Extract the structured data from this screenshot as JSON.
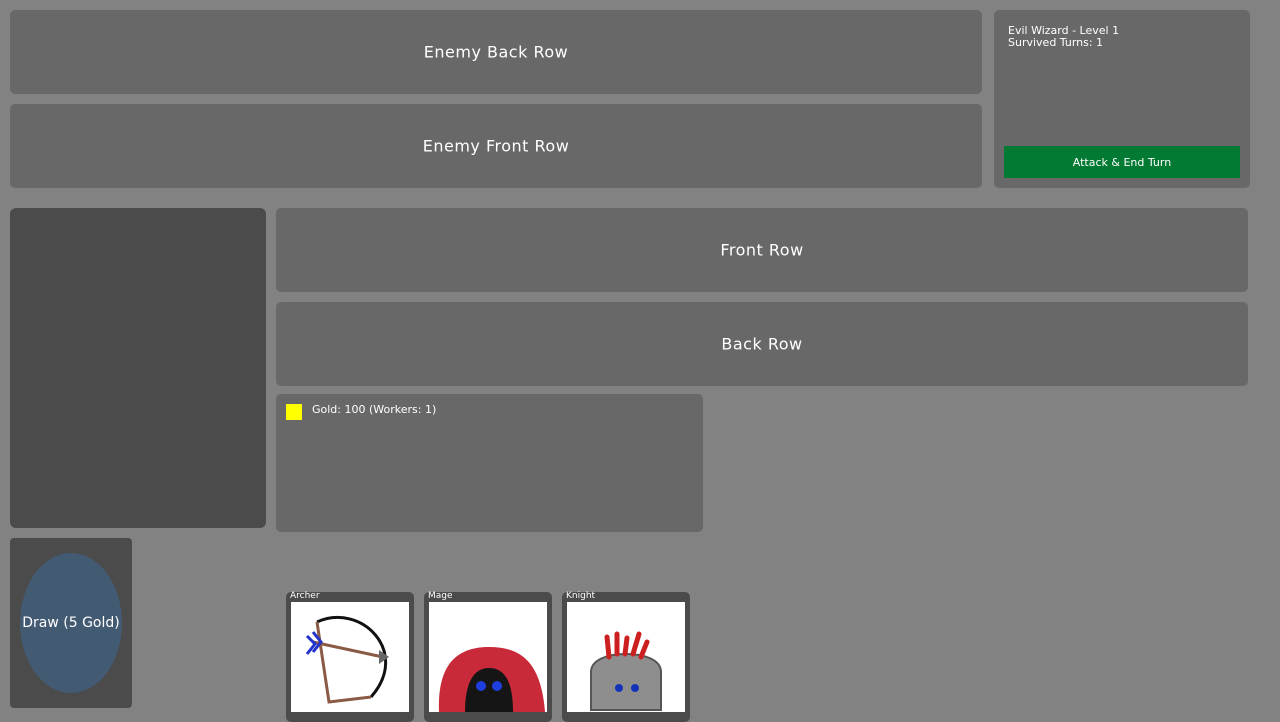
{
  "rows": {
    "enemy_back": "Enemy Back Row",
    "enemy_front": "Enemy Front Row",
    "front": "Front Row",
    "back": "Back Row"
  },
  "enemy_info": {
    "title": "Evil Wizard - Level 1",
    "turns": "Survived Turns: 1",
    "end_turn_label": "Attack & End Turn"
  },
  "gold": {
    "text": "Gold: 100 (Workers: 1)",
    "swatch_color": "#ffff00"
  },
  "draw": {
    "label": "Draw (5 Gold)"
  },
  "hand": [
    {
      "name": "Archer",
      "icon": "bow-and-arrow-icon"
    },
    {
      "name": "Mage",
      "icon": "hooded-mage-icon"
    },
    {
      "name": "Knight",
      "icon": "knight-helmet-icon"
    }
  ]
}
